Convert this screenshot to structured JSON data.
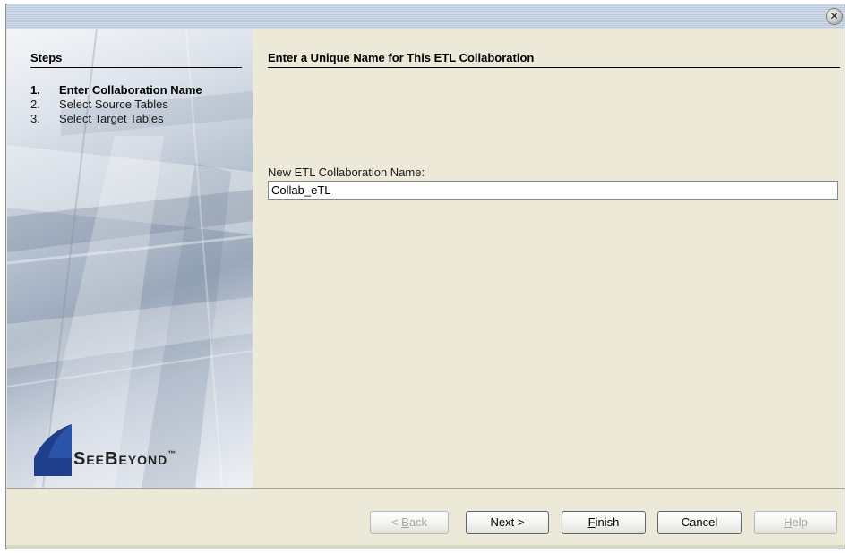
{
  "window": {
    "close_icon": "close-icon"
  },
  "sidebar": {
    "title": "Steps",
    "steps": [
      {
        "num": "1.",
        "label": "Enter Collaboration Name",
        "active": true
      },
      {
        "num": "2.",
        "label": "Select Source Tables",
        "active": false
      },
      {
        "num": "3.",
        "label": "Select Target Tables",
        "active": false
      }
    ],
    "logo_text": "SeeBeyond",
    "logo_mark": "™"
  },
  "main": {
    "title": "Enter a Unique Name for This ETL Collaboration",
    "field_label": "New ETL Collaboration Name:",
    "field_value": "Collab_eTL"
  },
  "buttons": {
    "back": {
      "prefix": "< ",
      "accel": "B",
      "rest": "ack",
      "enabled": false
    },
    "next": {
      "label": "Next >",
      "enabled": true
    },
    "finish": {
      "accel": "F",
      "rest": "inish",
      "enabled": true
    },
    "cancel": {
      "label": "Cancel",
      "enabled": true
    },
    "help": {
      "accel": "H",
      "rest": "elp",
      "enabled": false
    }
  },
  "colors": {
    "panel_bg": "#ece9d8",
    "title_bar": "#b7c6da",
    "logo_blue": "#1f3f8a"
  }
}
